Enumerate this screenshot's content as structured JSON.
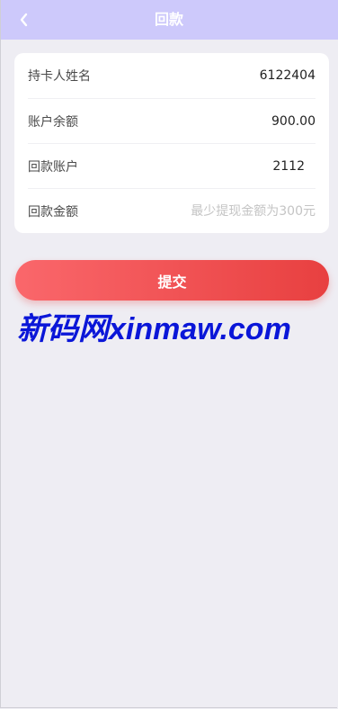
{
  "header": {
    "title": "回款",
    "back_icon": "chevron-left-icon"
  },
  "form": {
    "rows": [
      {
        "label": "持卡人姓名",
        "value": "6122404"
      },
      {
        "label": "账户余额",
        "value": "900.00"
      },
      {
        "label": "回款账户",
        "value": "2112"
      },
      {
        "label": "回款金额",
        "placeholder": "最少提现金额为300元",
        "value": ""
      }
    ]
  },
  "submit": {
    "label": "提交"
  },
  "watermark": {
    "text": "新码网xinmaw.com"
  },
  "colors": {
    "header_bg": "#cdc9fb",
    "page_bg": "#eeedf3",
    "button_start": "#fa676b",
    "button_end": "#e84040",
    "watermark": "#0a16d8"
  }
}
